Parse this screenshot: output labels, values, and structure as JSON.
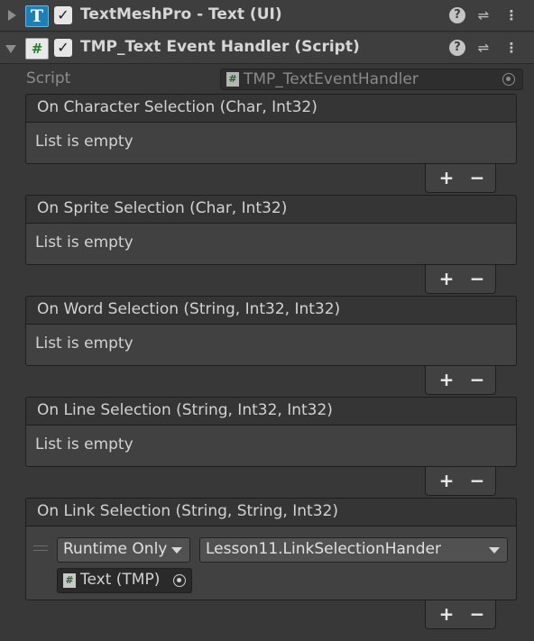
{
  "components": [
    {
      "title": "TextMeshPro - Text (UI)",
      "icon": "tmp-text-icon",
      "icon_glyph": "T",
      "enabled_glyph": "✓",
      "expanded": false
    },
    {
      "title": "TMP_Text Event Handler (Script)",
      "icon": "csharp-script-icon",
      "icon_glyph": "#",
      "enabled_glyph": "✓",
      "expanded": true
    }
  ],
  "header_icons": {
    "help": "?",
    "presets": "⇌",
    "menu": "⋮"
  },
  "script_field": {
    "label": "Script",
    "value": "TMP_TextEventHandler",
    "mini_glyph": "#"
  },
  "events": [
    {
      "title": "On Character Selection (Char, Int32)",
      "empty_text": "List is empty"
    },
    {
      "title": "On Sprite Selection (Char, Int32)",
      "empty_text": "List is empty"
    },
    {
      "title": "On Word Selection (String, Int32, Int32)",
      "empty_text": "List is empty"
    },
    {
      "title": "On Line Selection (String, Int32, Int32)",
      "empty_text": "List is empty"
    },
    {
      "title": "On Link Selection (String, String, Int32)",
      "listener": {
        "runtime_mode": "Runtime Only",
        "function": "Lesson11.LinkSelectionHander",
        "target": "Text (TMP)",
        "target_glyph": "#"
      }
    }
  ],
  "list_buttons": {
    "add": "+",
    "remove": "−"
  },
  "colors": {
    "background": "#383838",
    "header": "#3e3e3e",
    "tmp_icon": "#1c7fb5",
    "text": "#d2d2d2"
  }
}
